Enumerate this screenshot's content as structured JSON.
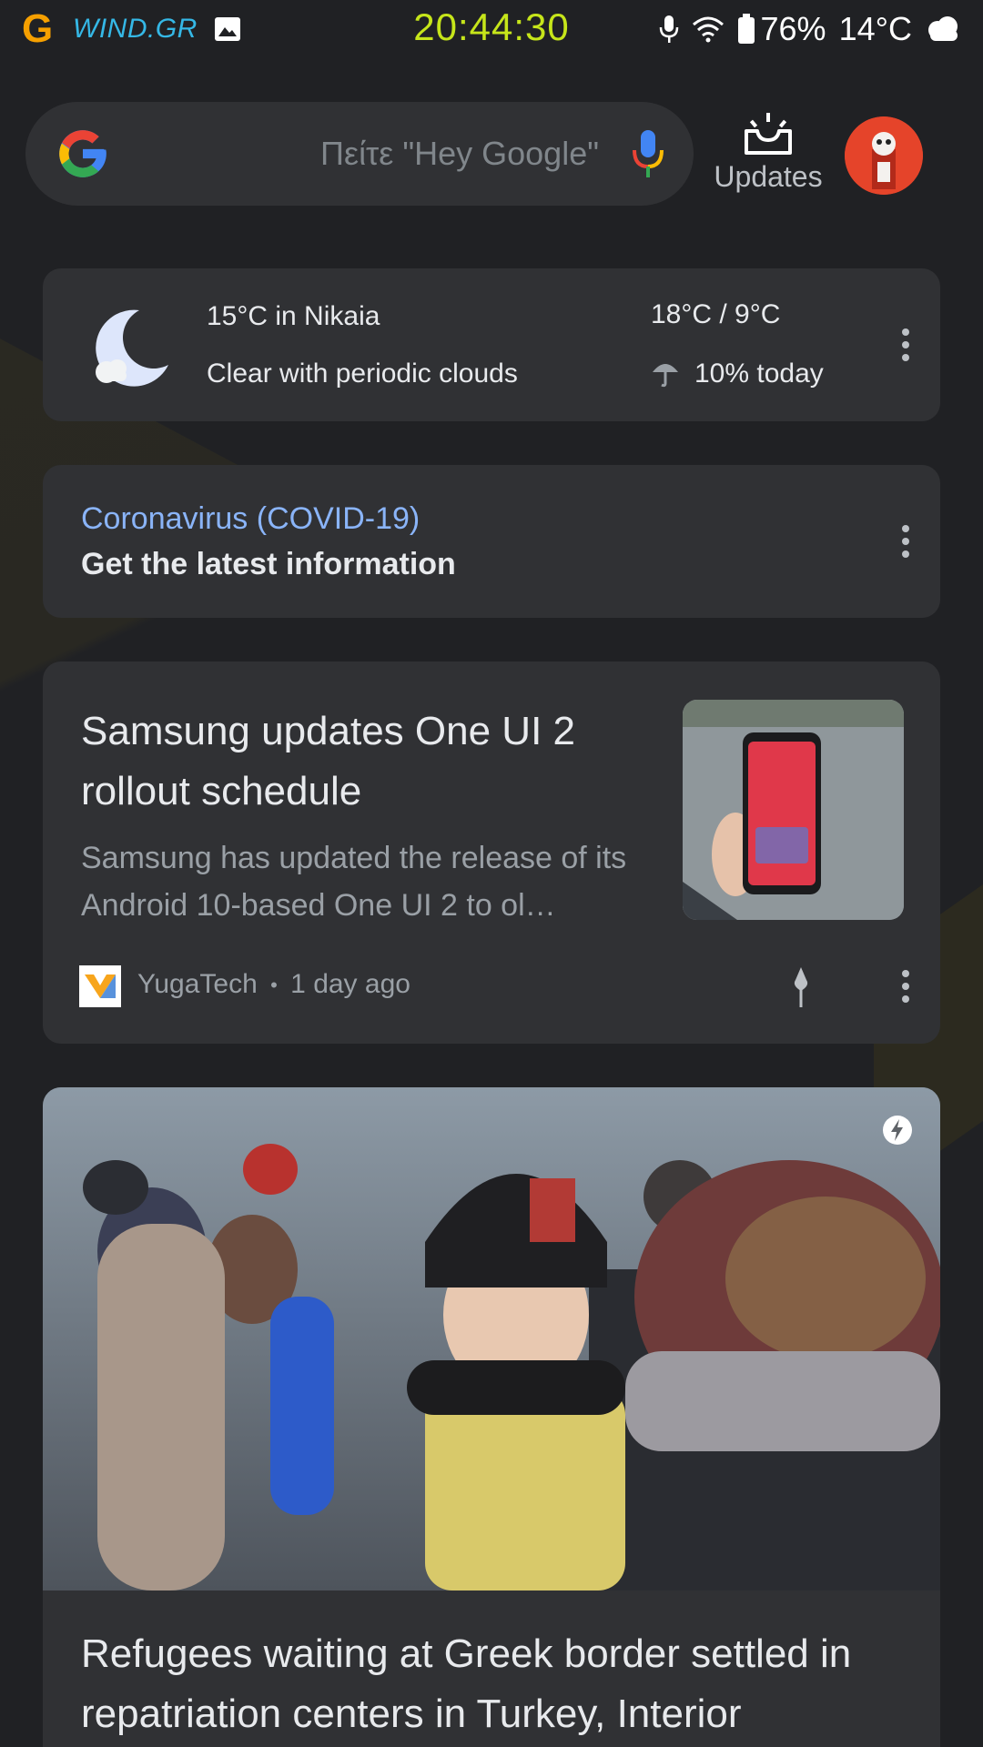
{
  "status_bar": {
    "carrier_logo": "G",
    "carrier": "WIND.GR",
    "clock": "20:44:30",
    "battery": "76%",
    "temperature": "14°C",
    "icons": [
      "gallery-icon",
      "mic-icon",
      "wifi-icon",
      "battery-icon",
      "cloud-icon"
    ]
  },
  "search": {
    "placeholder": "Πείτε \"Hey Google\"",
    "icons": [
      "google-logo-icon",
      "mic-icon"
    ]
  },
  "updates": {
    "label": "Updates"
  },
  "weather": {
    "location_temp": "15°C in Nikaia",
    "condition": "Clear with periodic clouds",
    "hi_lo": "18°C / 9°C",
    "rain": "10% today"
  },
  "covid": {
    "title": "Coronavirus (COVID-19)",
    "subtitle": "Get the latest information"
  },
  "news_card": {
    "title": "Samsung updates One UI 2 rollout schedule",
    "snippet": "Samsung has updated the release of its Android 10-based One UI 2 to ol…",
    "source": "YugaTech",
    "separator": "•",
    "age": "1 day ago"
  },
  "big_card": {
    "title": "Refugees waiting at Greek border settled in repatriation centers in Turkey, Interior"
  },
  "colors": {
    "background": "#202124",
    "card": "#303134",
    "accent_link": "#8ab4f8",
    "clock": "#c6e51a",
    "carrier": "#35b8e6"
  }
}
